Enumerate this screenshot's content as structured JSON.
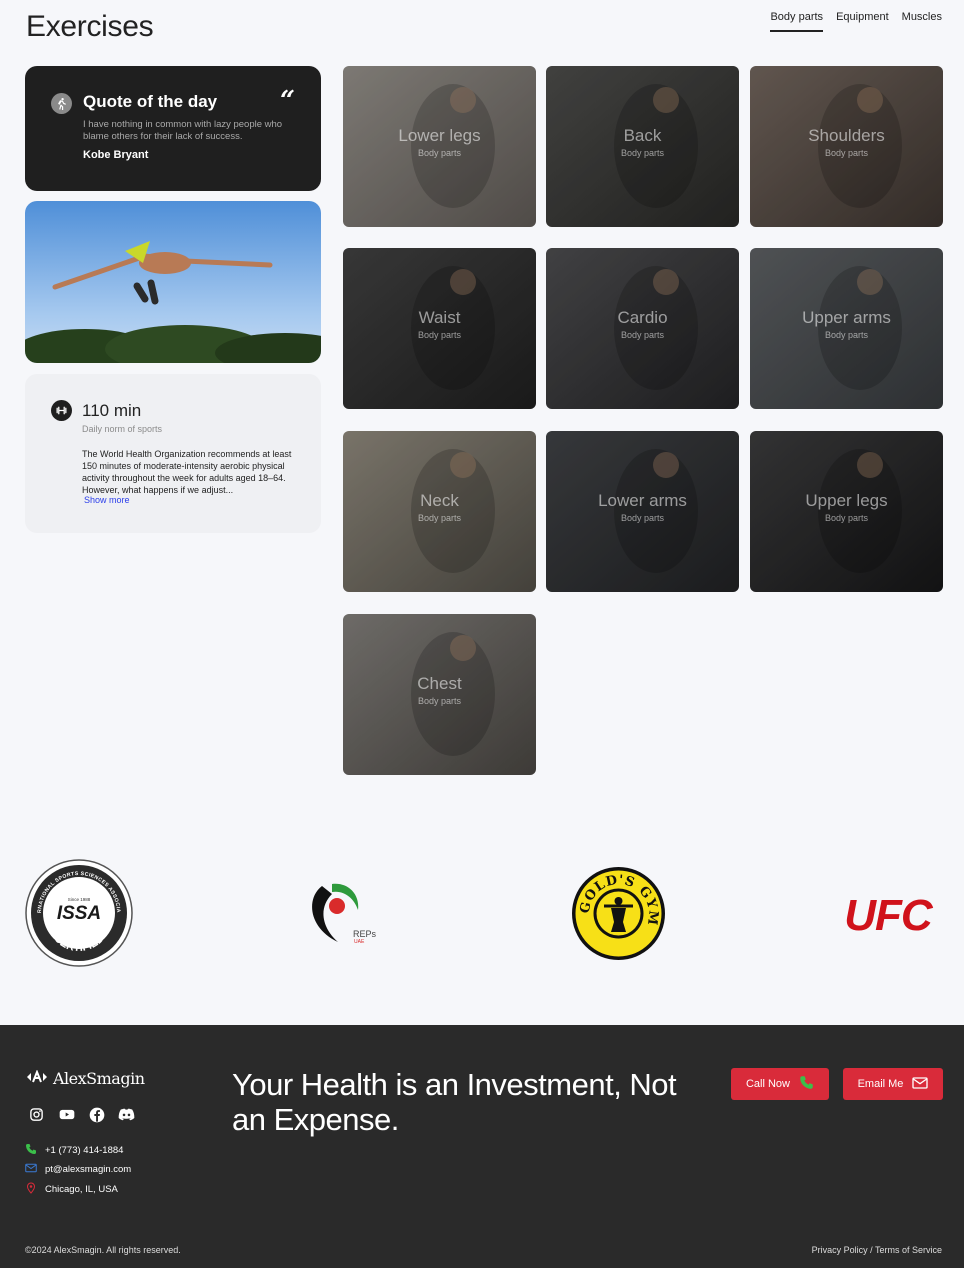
{
  "header": {
    "title": "Exercises",
    "tabs": [
      {
        "label": "Body parts",
        "active": true
      },
      {
        "label": "Equipment",
        "active": false
      },
      {
        "label": "Muscles",
        "active": false
      }
    ]
  },
  "quote": {
    "title": "Quote of the day",
    "mark": "“",
    "text": "I have nothing in common with lazy people who blame others for their lack of success.",
    "author": "Kobe Bryant"
  },
  "info": {
    "title": "110 min",
    "subtitle": "Daily norm of sports",
    "text": "The World Health Organization recommends at least 150 minutes of moderate-intensity aerobic physical activity throughout the week for adults aged 18–64. However, what happens if we adjust...",
    "more": "Show more"
  },
  "tiles": [
    {
      "name": "Lower legs",
      "sub": "Body parts",
      "colors": [
        "#8e8a84",
        "#5b5652"
      ]
    },
    {
      "name": "Back",
      "sub": "Body parts",
      "colors": [
        "#4a4a48",
        "#262624"
      ]
    },
    {
      "name": "Shoulders",
      "sub": "Body parts",
      "colors": [
        "#6e625a",
        "#3a322d"
      ]
    },
    {
      "name": "Waist",
      "sub": "Body parts",
      "colors": [
        "#3f3f3f",
        "#1d1d1d"
      ]
    },
    {
      "name": "Cardio",
      "sub": "Body parts",
      "colors": [
        "#4a4a4c",
        "#222224"
      ]
    },
    {
      "name": "Upper arms",
      "sub": "Body parts",
      "colors": [
        "#5a5d60",
        "#34373a"
      ]
    },
    {
      "name": "Neck",
      "sub": "Body parts",
      "colors": [
        "#8a8478",
        "#4d4a43"
      ]
    },
    {
      "name": "Lower arms",
      "sub": "Body parts",
      "colors": [
        "#3e4043",
        "#1f2022"
      ]
    },
    {
      "name": "Upper legs",
      "sub": "Body parts",
      "colors": [
        "#3a3a3b",
        "#151516"
      ]
    },
    {
      "name": "Chest",
      "sub": "Body parts",
      "colors": [
        "#7d7a76",
        "#46433f"
      ]
    }
  ],
  "logos": {
    "issa_top": "INTERNATIONAL SPORTS SCIENCES ASSOCIATION",
    "issa_since": "Since 1988",
    "issa_mark": "ISSA",
    "issa_bottom": "CERTIFIED",
    "reps": "REPs",
    "reps_sub": "UAE",
    "golds": "GOLD'S GYM",
    "ufc": "UFC"
  },
  "footer": {
    "brand": "AlexSmagin",
    "slogan": "Your Health is an Investment, Not an Expense.",
    "phone": "+1 (773) 414-1884",
    "email": "pt@alexsmagin.com",
    "location": "Chicago, IL, USA",
    "call_label": "Call Now",
    "email_label": "Email Me",
    "copyright": "©2024 AlexSmagin. All rights reserved.",
    "legal": "Privacy Policy / Terms of Service"
  },
  "colors": {
    "accent": "#d92b3a",
    "dark": "#1f1f1f",
    "link": "#2b3eea",
    "phone_icon": "#3bbf4a",
    "email_icon": "#3a7bd5",
    "location_icon": "#d92b3a"
  }
}
